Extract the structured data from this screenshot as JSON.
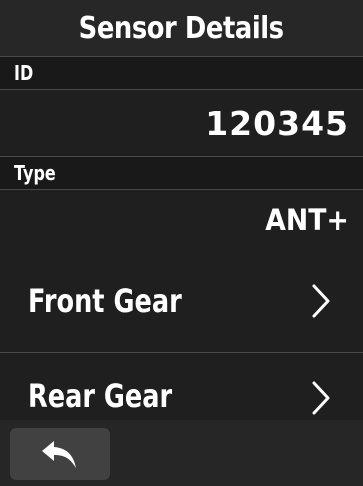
{
  "header": {
    "title": "Sensor Details"
  },
  "id_section": {
    "label": "ID",
    "value": "120345"
  },
  "type_section": {
    "label": "Type",
    "value": "ANT+"
  },
  "menu": {
    "items": [
      {
        "label": "Front Gear",
        "icon": "chevron-right-icon"
      },
      {
        "label": "Rear Gear",
        "icon": "chevron-right-icon"
      }
    ]
  },
  "footer": {
    "back_icon": "back-arrow-icon"
  },
  "colors": {
    "background": "#202020",
    "label_band": "#191919",
    "divider": "#4a4a4a",
    "button": "#414141",
    "text": "#ffffff"
  }
}
